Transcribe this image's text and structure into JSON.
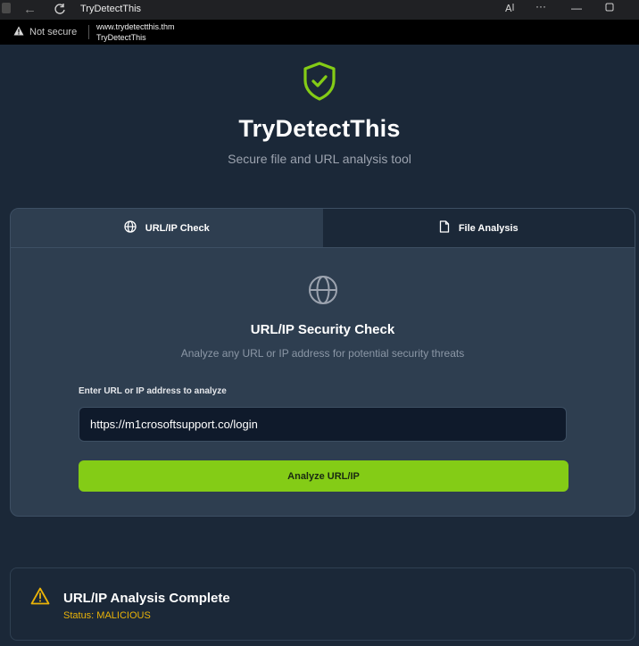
{
  "titlebar": {
    "title": "TryDetectThis",
    "icons": [
      "back-arrow-icon",
      "reload-icon",
      "read-aloud-icon",
      "more-icon",
      "minimize-icon",
      "maximize-icon"
    ]
  },
  "addressbar": {
    "security_label": "Not secure",
    "url": "www.trydetectthis.thm",
    "page_title": "TryDetectThis"
  },
  "header": {
    "brand": "TryDetectThis",
    "tagline": "Secure file and URL analysis tool",
    "logo_color": "#84cc16"
  },
  "tabs": [
    {
      "label": "URL/IP Check",
      "icon": "globe-icon",
      "active": true
    },
    {
      "label": "File Analysis",
      "icon": "file-icon",
      "active": false
    }
  ],
  "url_check": {
    "title": "URL/IP Security Check",
    "subtitle": "Analyze any URL or IP address for potential security threats",
    "field_label": "Enter URL or IP address to analyze",
    "input_value": "https://m1crosoftsupport.co/login",
    "button_label": "Analyze URL/IP",
    "button_color": "#84cc16"
  },
  "result": {
    "title": "URL/IP Analysis Complete",
    "status": "Status: MALICIOUS",
    "status_color": "#eab308"
  }
}
